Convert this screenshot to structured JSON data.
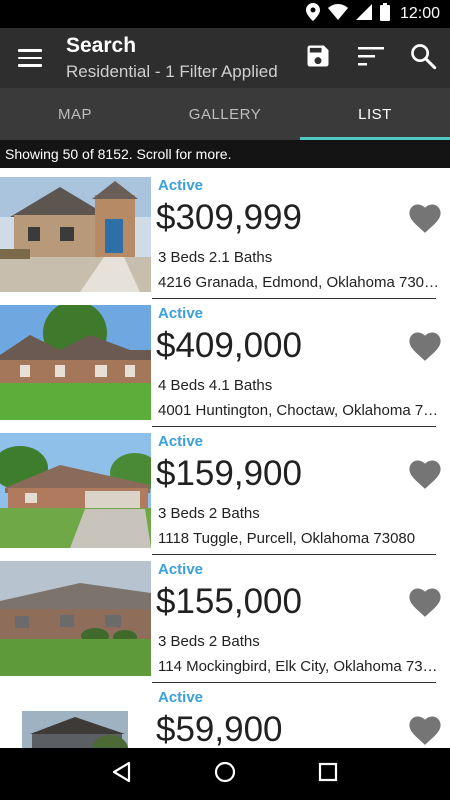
{
  "status_bar": {
    "time": "12:00",
    "icons": [
      "location-icon",
      "wifi-icon",
      "signal-icon",
      "battery-icon"
    ]
  },
  "app_bar": {
    "title": "Search",
    "subtitle": "Residential - 1 Filter Applied",
    "actions": [
      "save-icon",
      "sort-icon",
      "search-icon"
    ]
  },
  "tabs": [
    {
      "label": "MAP",
      "active": false
    },
    {
      "label": "GALLERY",
      "active": false
    },
    {
      "label": "LIST",
      "active": true
    }
  ],
  "info_bar": {
    "text": "Showing 50 of 8152. Scroll for more."
  },
  "listings": [
    {
      "status": "Active",
      "price": "$309,999",
      "beds_baths": "3 Beds 2.1 Baths",
      "address": "4216 Granada, Edmond, Oklahoma 730…"
    },
    {
      "status": "Active",
      "price": "$409,000",
      "beds_baths": "4 Beds 4.1 Baths",
      "address": "4001 Huntington, Choctaw, Oklahoma 7…"
    },
    {
      "status": "Active",
      "price": "$159,900",
      "beds_baths": "3 Beds 2 Baths",
      "address": "1118 Tuggle, Purcell, Oklahoma 73080"
    },
    {
      "status": "Active",
      "price": "$155,000",
      "beds_baths": "3 Beds 2 Baths",
      "address": "114 Mockingbird, Elk City, Oklahoma 73…"
    },
    {
      "status": "Active",
      "price": "$59,900",
      "beds_baths": "",
      "address": ""
    }
  ],
  "colors": {
    "app_bar": "#2e2e2e",
    "tabs": "#3a3a3a",
    "tab_indicator": "#4ec9c1",
    "status_active": "#3aa0dc",
    "favorite_icon": "#757575"
  }
}
